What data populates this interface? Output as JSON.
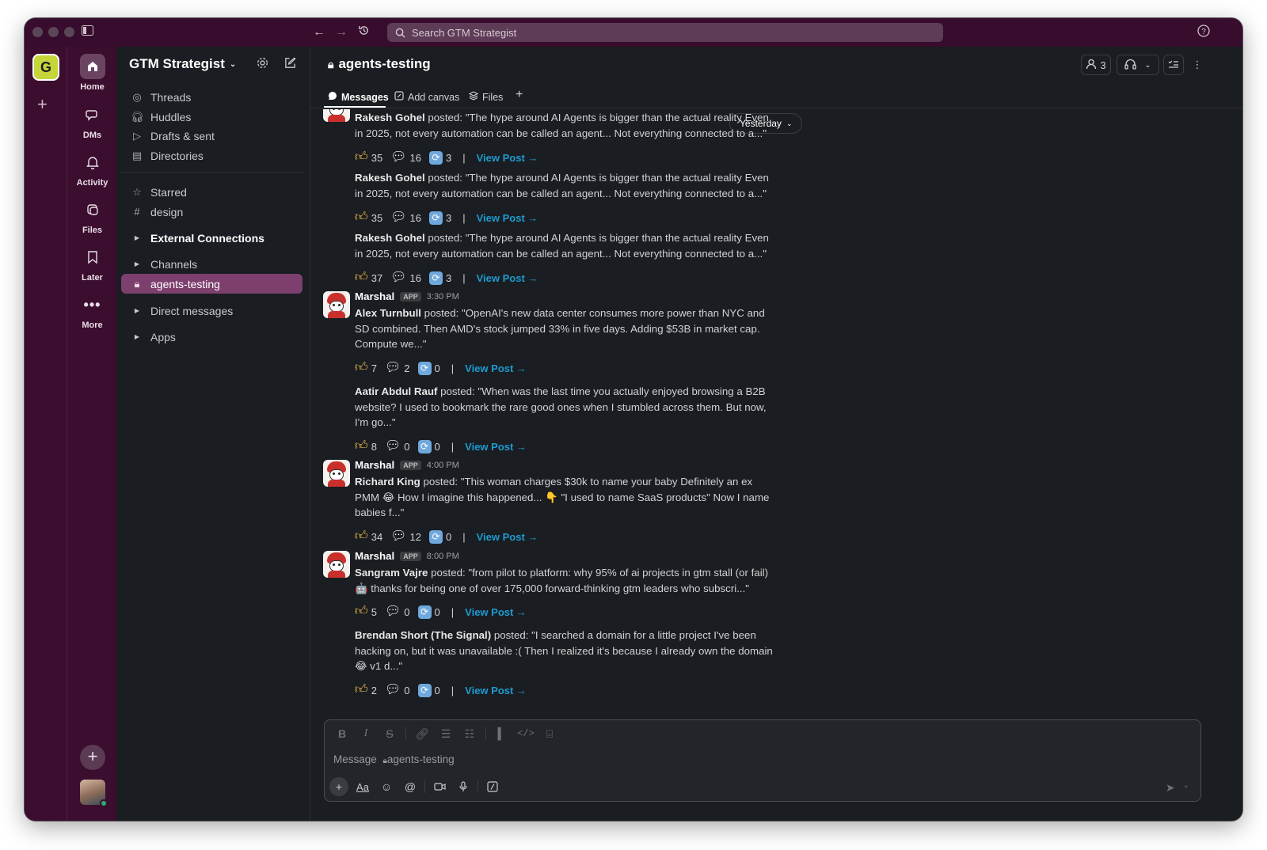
{
  "search": {
    "placeholder": "Search GTM Strategist"
  },
  "workspace": {
    "badge": "G",
    "name": "GTM Strategist"
  },
  "nav": {
    "home": "Home",
    "dms": "DMs",
    "activity": "Activity",
    "files": "Files",
    "later": "Later",
    "more": "More"
  },
  "sidebar": {
    "items": [
      {
        "label": "Threads",
        "icon": "threads-icon"
      },
      {
        "label": "Huddles",
        "icon": "headphones-icon"
      },
      {
        "label": "Drafts & sent",
        "icon": "send-icon"
      },
      {
        "label": "Directories",
        "icon": "directory-icon"
      }
    ],
    "starred": "Starred",
    "design": "design",
    "external": "External Connections",
    "channels": "Channels",
    "active_channel": "agents-testing",
    "direct_messages": "Direct messages",
    "apps": "Apps"
  },
  "channel": {
    "name": "agents-testing",
    "member_count": "3"
  },
  "tabs": {
    "messages": "Messages",
    "add_canvas": "Add canvas",
    "files": "Files"
  },
  "day_pill": "Yesterday",
  "posts": [
    {
      "author": "Rakesh Gohel",
      "text": " posted: \"The hype around AI Agents is bigger than the actual reality Even in 2025, not every automation can be called an agent... Not everything connected to a...\"",
      "likes": "35",
      "comments": "16",
      "reposts": "3",
      "link": "View Post →"
    },
    {
      "author": "Rakesh Gohel",
      "text": " posted: \"The hype around AI Agents is bigger than the actual reality Even in 2025, not every automation can be called an agent... Not everything connected to a...\"",
      "likes": "35",
      "comments": "16",
      "reposts": "3",
      "link": "View Post →"
    },
    {
      "author": "Rakesh Gohel",
      "text": " posted: \"The hype around AI Agents is bigger than the actual reality Even in 2025, not every automation can be called an agent... Not everything connected to a...\"",
      "likes": "37",
      "comments": "16",
      "reposts": "3",
      "link": "View Post →"
    },
    {
      "author": "Alex Turnbull",
      "text": " posted: \"OpenAI's new data center consumes more power than NYC and SD combined. Then AMD's stock jumped 33% in five days. Adding $53B in market cap. Compute we...\"",
      "likes": "7",
      "comments": "2",
      "reposts": "0",
      "link": "View Post →"
    },
    {
      "author": "Aatir Abdul Rauf",
      "text": " posted: \"When was the last time you actually enjoyed browsing a B2B website? I used to bookmark the rare good ones when I stumbled across them. But now, I'm go...\"",
      "likes": "8",
      "comments": "0",
      "reposts": "0",
      "link": "View Post →"
    },
    {
      "author": "Richard King",
      "text": " posted: \"This woman charges $30k to name your baby Definitely an ex PMM 😂 How I imagine this happened... 👇 \"I used to name SaaS products\" Now I name babies f...\"",
      "likes": "34",
      "comments": "12",
      "reposts": "0",
      "link": "View Post →"
    },
    {
      "author": "Sangram Vajre",
      "text": " posted: \"from pilot to platform: why 95% of ai projects in gtm stall (or fail) 🤖 thanks for being one of over 175,000 forward-thinking gtm leaders who subscri...\"",
      "likes": "5",
      "comments": "0",
      "reposts": "0",
      "link": "View Post →"
    },
    {
      "author": "Brendan Short (The Signal)",
      "text": " posted: \"I searched a domain for a little project I've been hacking on, but it was unavailable :( Then I realized it's because I already own the domain 😂 v1 d...\"",
      "likes": "2",
      "comments": "0",
      "reposts": "0",
      "link": "View Post →"
    }
  ],
  "bot_messages": [
    {
      "name": "Marshal",
      "tag": "APP",
      "time": "3:30 PM"
    },
    {
      "name": "Marshal",
      "tag": "APP",
      "time": "4:00 PM"
    },
    {
      "name": "Marshal",
      "tag": "APP",
      "time": "8:00 PM"
    }
  ],
  "composer": {
    "placeholder_prefix": "Message",
    "channel": "agents-testing"
  },
  "colors": {
    "aubergine": "#3b0d2f",
    "active_channel": "#7d3f6e",
    "link": "#1d9bd1",
    "background": "#1a1d21"
  }
}
